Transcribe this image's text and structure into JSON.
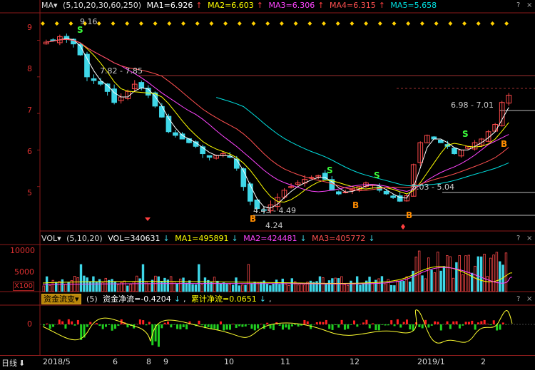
{
  "price_header": {
    "name": "MA▾",
    "params": "(5,10,20,30,60,250)",
    "ma1": "MA1=6.926",
    "ma2": "MA2=6.603",
    "ma3": "MA3=6.306",
    "ma4": "MA4=6.315",
    "ma5": "MA5=5.658",
    "arrow": "↑"
  },
  "vol_header": {
    "name": "VOL▾",
    "params": "(5,10,20)",
    "vol": "VOL=340631",
    "ma1": "MA1=495891",
    "ma2": "MA2=424481",
    "ma3": "MA3=405772",
    "arrow": "↓"
  },
  "flow_header": {
    "name": "资金流变▾",
    "params": "(5)",
    "net": "资金净流=-0.4204",
    "cum": "累计净流=0.0651",
    "arrow": "↓",
    "tail": ","
  },
  "window_controls": {
    "help": "?",
    "close": "×"
  },
  "price_axis": [
    "9",
    "8",
    "7",
    "6",
    "5"
  ],
  "vol_axis": [
    "10000",
    "5000",
    "X100"
  ],
  "flow_axis": [
    "0"
  ],
  "annotations": {
    "high": "9.16",
    "range1": "7.82 - 7.85",
    "range2": "4.43 - 4.49",
    "low": "4.24",
    "range3": "5.03 - 5.04",
    "range4": "6.98 - 7.01"
  },
  "signals": {
    "sell": "S",
    "buy": "B"
  },
  "time_axis": {
    "period": "日线",
    "down_arrow": "⬇",
    "labels": [
      "2018/5",
      "6",
      "8",
      "9",
      "10",
      "11",
      "12",
      "2019/1",
      "2"
    ]
  },
  "colors": {
    "up": "#ff4a4a",
    "down": "#3fd7e8",
    "ma1": "#ffffff",
    "ma2": "#ffff00",
    "ma3": "#ff44ff",
    "ma4": "#ff5050",
    "ma5": "#00e0e0",
    "grid": "#8b1a1a",
    "sell": "#3cff3c",
    "buy": "#ff8c00",
    "flow_line": "#ffff30"
  },
  "chart_data": {
    "type": "candlestick",
    "x_labels": [
      "2018/5",
      "6",
      "8",
      "9",
      "10",
      "11",
      "12",
      "2019/1",
      "2"
    ],
    "y_range": [
      4.0,
      9.4
    ],
    "price_levels": [
      {
        "label": "9.16",
        "value": 9.16
      },
      {
        "label": "7.82 - 7.85",
        "value": 7.85
      },
      {
        "label": "4.43 - 4.49",
        "value": 4.49
      },
      {
        "label": "4.24",
        "value": 4.24
      },
      {
        "label": "5.03 - 5.04",
        "value": 5.04
      },
      {
        "label": "6.98 - 7.01",
        "value": 7.01
      }
    ],
    "close_series": [
      8.95,
      9.0,
      9.1,
      9.05,
      8.9,
      8.6,
      8.0,
      7.9,
      7.8,
      7.6,
      7.3,
      7.45,
      7.6,
      7.8,
      7.7,
      7.5,
      7.2,
      6.9,
      6.5,
      6.4,
      6.3,
      6.2,
      6.1,
      5.9,
      5.8,
      5.85,
      5.9,
      5.8,
      5.5,
      5.0,
      4.6,
      4.4,
      4.35,
      4.5,
      4.7,
      4.9,
      5.0,
      5.1,
      5.2,
      5.25,
      5.3,
      5.2,
      4.9,
      4.8,
      4.85,
      4.95,
      5.0,
      5.1,
      5.05,
      4.9,
      4.8,
      4.7,
      4.6,
      4.75,
      5.6,
      6.2,
      6.4,
      6.3,
      6.2,
      6.1,
      5.9,
      6.0,
      6.1,
      6.2,
      6.3,
      6.5,
      6.7,
      7.3,
      7.5
    ]
  }
}
